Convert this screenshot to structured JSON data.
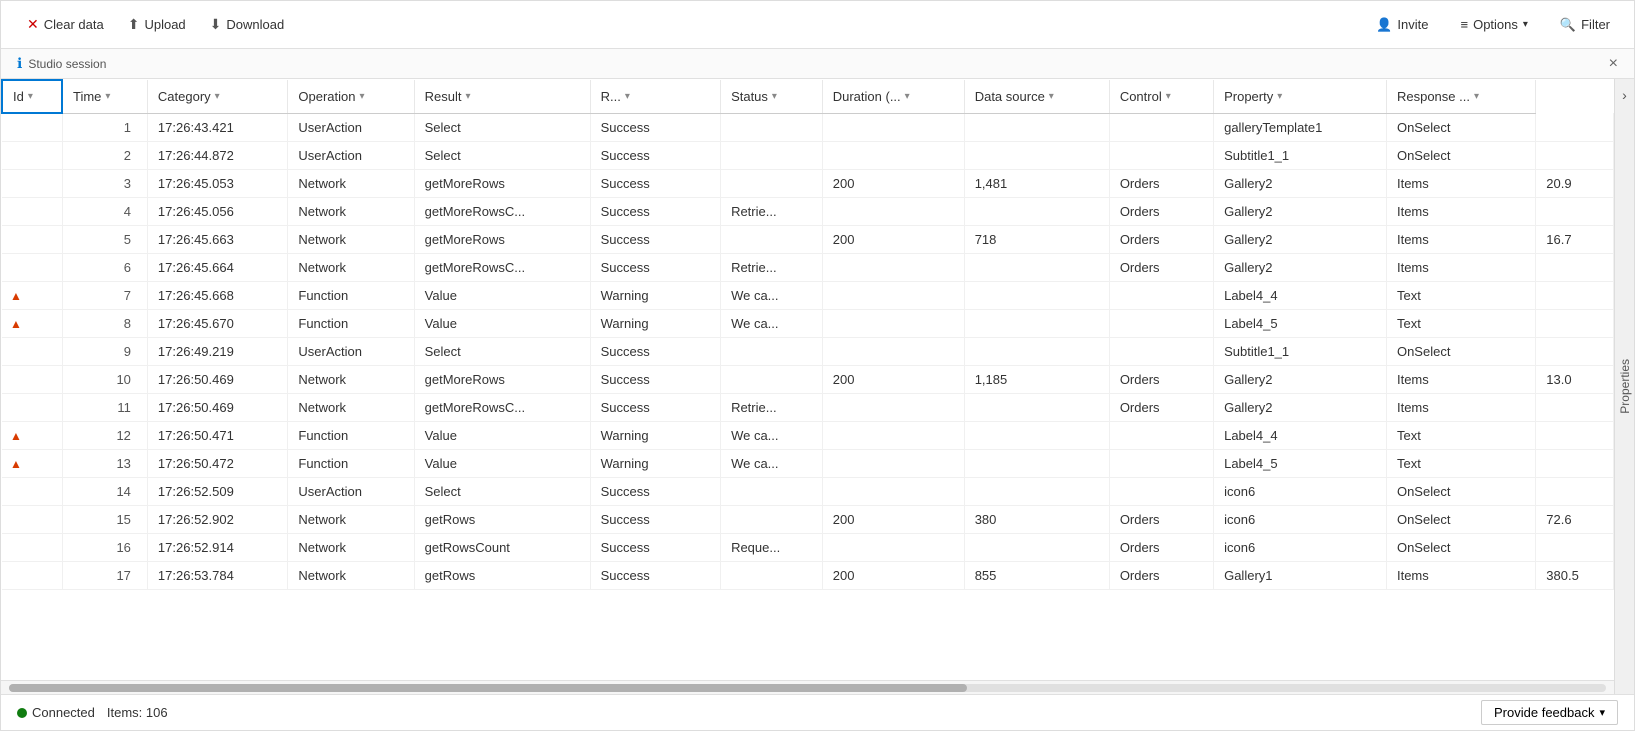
{
  "toolbar": {
    "clear_label": "Clear data",
    "upload_label": "Upload",
    "download_label": "Download",
    "invite_label": "Invite",
    "options_label": "Options",
    "filter_label": "Filter"
  },
  "session": {
    "label": "Studio session",
    "close_label": "×"
  },
  "table": {
    "columns": [
      {
        "id": "col-id",
        "label": "Id",
        "sortable": true
      },
      {
        "id": "col-time",
        "label": "Time",
        "sortable": true
      },
      {
        "id": "col-category",
        "label": "Category",
        "sortable": true
      },
      {
        "id": "col-operation",
        "label": "Operation",
        "sortable": true
      },
      {
        "id": "col-result",
        "label": "Result",
        "sortable": true
      },
      {
        "id": "col-r",
        "label": "R...",
        "sortable": true
      },
      {
        "id": "col-status",
        "label": "Status",
        "sortable": true
      },
      {
        "id": "col-duration",
        "label": "Duration (...",
        "sortable": true
      },
      {
        "id": "col-datasource",
        "label": "Data source",
        "sortable": true
      },
      {
        "id": "col-control",
        "label": "Control",
        "sortable": true
      },
      {
        "id": "col-property",
        "label": "Property",
        "sortable": true
      },
      {
        "id": "col-response",
        "label": "Response ...",
        "sortable": true
      }
    ],
    "rows": [
      {
        "id": "1",
        "time": "17:26:43.421",
        "category": "UserAction",
        "operation": "Select",
        "result": "Success",
        "r": "",
        "status": "",
        "duration": "",
        "datasource": "",
        "control": "galleryTemplate1",
        "property": "OnSelect",
        "response": "",
        "warning": false
      },
      {
        "id": "2",
        "time": "17:26:44.872",
        "category": "UserAction",
        "operation": "Select",
        "result": "Success",
        "r": "",
        "status": "",
        "duration": "",
        "datasource": "",
        "control": "Subtitle1_1",
        "property": "OnSelect",
        "response": "",
        "warning": false
      },
      {
        "id": "3",
        "time": "17:26:45.053",
        "category": "Network",
        "operation": "getMoreRows",
        "result": "Success",
        "r": "",
        "status": "200",
        "duration": "1,481",
        "datasource": "Orders",
        "control": "Gallery2",
        "property": "Items",
        "response": "20.9",
        "warning": false
      },
      {
        "id": "4",
        "time": "17:26:45.056",
        "category": "Network",
        "operation": "getMoreRowsC...",
        "result": "Success",
        "r": "Retrie...",
        "status": "",
        "duration": "",
        "datasource": "Orders",
        "control": "Gallery2",
        "property": "Items",
        "response": "",
        "warning": false
      },
      {
        "id": "5",
        "time": "17:26:45.663",
        "category": "Network",
        "operation": "getMoreRows",
        "result": "Success",
        "r": "",
        "status": "200",
        "duration": "718",
        "datasource": "Orders",
        "control": "Gallery2",
        "property": "Items",
        "response": "16.7",
        "warning": false
      },
      {
        "id": "6",
        "time": "17:26:45.664",
        "category": "Network",
        "operation": "getMoreRowsC...",
        "result": "Success",
        "r": "Retrie...",
        "status": "",
        "duration": "",
        "datasource": "Orders",
        "control": "Gallery2",
        "property": "Items",
        "response": "",
        "warning": false
      },
      {
        "id": "7",
        "time": "17:26:45.668",
        "category": "Function",
        "operation": "Value",
        "result": "Warning",
        "r": "We ca...",
        "status": "",
        "duration": "",
        "datasource": "",
        "control": "Label4_4",
        "property": "Text",
        "response": "",
        "warning": true
      },
      {
        "id": "8",
        "time": "17:26:45.670",
        "category": "Function",
        "operation": "Value",
        "result": "Warning",
        "r": "We ca...",
        "status": "",
        "duration": "",
        "datasource": "",
        "control": "Label4_5",
        "property": "Text",
        "response": "",
        "warning": true
      },
      {
        "id": "9",
        "time": "17:26:49.219",
        "category": "UserAction",
        "operation": "Select",
        "result": "Success",
        "r": "",
        "status": "",
        "duration": "",
        "datasource": "",
        "control": "Subtitle1_1",
        "property": "OnSelect",
        "response": "",
        "warning": false
      },
      {
        "id": "10",
        "time": "17:26:50.469",
        "category": "Network",
        "operation": "getMoreRows",
        "result": "Success",
        "r": "",
        "status": "200",
        "duration": "1,185",
        "datasource": "Orders",
        "control": "Gallery2",
        "property": "Items",
        "response": "13.0",
        "warning": false
      },
      {
        "id": "11",
        "time": "17:26:50.469",
        "category": "Network",
        "operation": "getMoreRowsC...",
        "result": "Success",
        "r": "Retrie...",
        "status": "",
        "duration": "",
        "datasource": "Orders",
        "control": "Gallery2",
        "property": "Items",
        "response": "",
        "warning": false
      },
      {
        "id": "12",
        "time": "17:26:50.471",
        "category": "Function",
        "operation": "Value",
        "result": "Warning",
        "r": "We ca...",
        "status": "",
        "duration": "",
        "datasource": "",
        "control": "Label4_4",
        "property": "Text",
        "response": "",
        "warning": true
      },
      {
        "id": "13",
        "time": "17:26:50.472",
        "category": "Function",
        "operation": "Value",
        "result": "Warning",
        "r": "We ca...",
        "status": "",
        "duration": "",
        "datasource": "",
        "control": "Label4_5",
        "property": "Text",
        "response": "",
        "warning": true
      },
      {
        "id": "14",
        "time": "17:26:52.509",
        "category": "UserAction",
        "operation": "Select",
        "result": "Success",
        "r": "",
        "status": "",
        "duration": "",
        "datasource": "",
        "control": "icon6",
        "property": "OnSelect",
        "response": "",
        "warning": false
      },
      {
        "id": "15",
        "time": "17:26:52.902",
        "category": "Network",
        "operation": "getRows",
        "result": "Success",
        "r": "",
        "status": "200",
        "duration": "380",
        "datasource": "Orders",
        "control": "icon6",
        "property": "OnSelect",
        "response": "72.6",
        "warning": false
      },
      {
        "id": "16",
        "time": "17:26:52.914",
        "category": "Network",
        "operation": "getRowsCount",
        "result": "Success",
        "r": "Reque...",
        "status": "",
        "duration": "",
        "datasource": "Orders",
        "control": "icon6",
        "property": "OnSelect",
        "response": "",
        "warning": false
      },
      {
        "id": "17",
        "time": "17:26:53.784",
        "category": "Network",
        "operation": "getRows",
        "result": "Success",
        "r": "",
        "status": "200",
        "duration": "855",
        "datasource": "Orders",
        "control": "Gallery1",
        "property": "Items",
        "response": "380.5",
        "warning": false
      }
    ]
  },
  "right_panel": {
    "label": "Properties"
  },
  "status": {
    "connected_label": "Connected",
    "items_label": "Items: 106"
  },
  "feedback": {
    "label": "Provide feedback"
  }
}
